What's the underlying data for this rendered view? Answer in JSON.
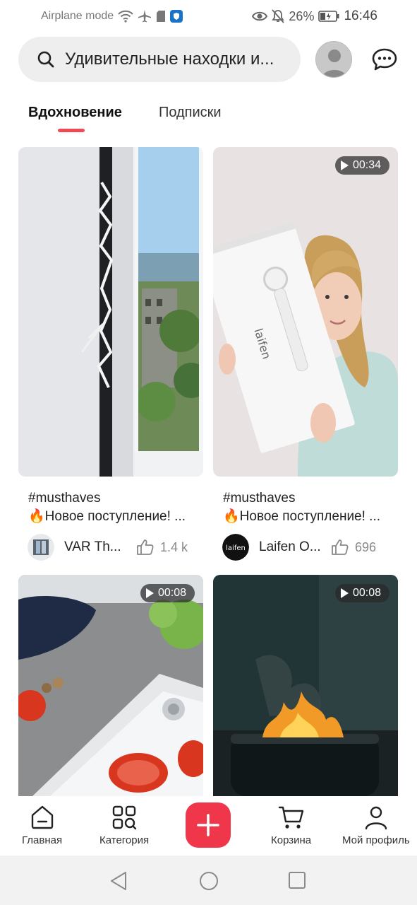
{
  "status_bar": {
    "left_text": "Airplane mode",
    "battery_percent": "26%",
    "time": "16:46",
    "icons": [
      "wifi-icon",
      "airplane-icon",
      "sim-icon",
      "shield-app-icon",
      "eye-icon",
      "mute-bell-icon",
      "battery-icon"
    ]
  },
  "header": {
    "search_text": "Удивительные находки и...",
    "search_icon": "search-icon",
    "chat_icon": "chat-icon"
  },
  "tabs": [
    {
      "label": "Вдохновение",
      "active": true
    },
    {
      "label": "Подписки",
      "active": false
    }
  ],
  "feed": [
    {
      "tag": "#musthaves",
      "title": "🔥Новое поступление! ...",
      "author": "VAR Th...",
      "likes": "1.4 k",
      "duration": ""
    },
    {
      "tag": "#musthaves",
      "title": "🔥Новое поступление! ...",
      "author": "Laifen O...",
      "likes": "696",
      "duration": "00:34",
      "brand_text": "laifen"
    },
    {
      "duration": "00:08"
    },
    {
      "duration": "00:08"
    }
  ],
  "bottom_nav": [
    {
      "label": "Главная",
      "icon": "home-icon"
    },
    {
      "label": "Категория",
      "icon": "category-icon"
    },
    {
      "label": "",
      "icon": "plus-icon"
    },
    {
      "label": "Корзина",
      "icon": "cart-icon"
    },
    {
      "label": "Мой профиль",
      "icon": "profile-icon"
    }
  ],
  "colors": {
    "accent": "#f0364a",
    "tab_indicator": "#f04a55",
    "search_bg": "#eeeeef"
  }
}
